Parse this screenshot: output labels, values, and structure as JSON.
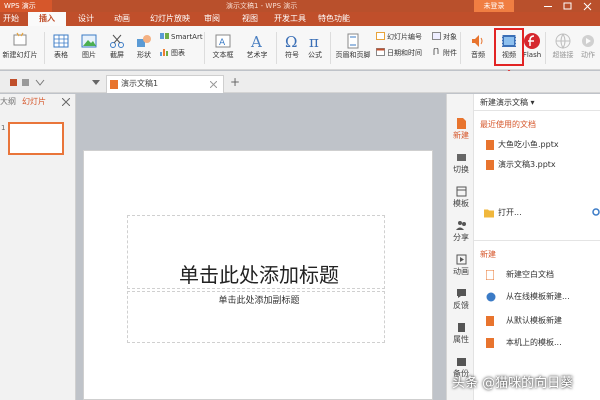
{
  "window": {
    "app_badge": "WPS 演示",
    "doc_title": "演示文稿1 - WPS 演示",
    "login_label": "未登录"
  },
  "menu": {
    "tabs": [
      {
        "label": "开始"
      },
      {
        "label": "插入",
        "active": true
      },
      {
        "label": "设计"
      },
      {
        "label": "动画"
      },
      {
        "label": "幻灯片放映"
      },
      {
        "label": "审阅"
      },
      {
        "label": "视图"
      },
      {
        "label": "开发工具"
      },
      {
        "label": "特色功能"
      }
    ]
  },
  "ribbon": {
    "new_slide": "新建幻灯片",
    "table": "表格",
    "picture": "图片",
    "screenshot": "截屏",
    "shape": "形状",
    "smartart": "SmartArt",
    "chart": "图表",
    "textbox": "文本框",
    "wordart": "艺术字",
    "symbol": "符号",
    "formula": "公式",
    "header_footer": "页眉和页脚",
    "slide_number": "幻灯片编号",
    "object": "对象",
    "date_time": "日期和时间",
    "attachment": "附件",
    "audio": "音频",
    "video": "视频",
    "flash": "Flash",
    "hyperlink": "超链接",
    "action": "动作",
    "colors": {
      "accent": "#c04f2b",
      "highlight": "#e22424"
    }
  },
  "tabs": {
    "doc_tab": "演示文稿1",
    "add": "+"
  },
  "left_panel": {
    "outline_tab": "大纲",
    "slides_tab": "幻灯片",
    "slide_number": "1"
  },
  "slide": {
    "title": "单击此处添加标题",
    "subtitle": "单击此处添加副标题"
  },
  "side_strip": [
    {
      "label": "新建"
    },
    {
      "label": "切换"
    },
    {
      "label": "模板"
    },
    {
      "label": "分享"
    },
    {
      "label": "动画"
    },
    {
      "label": "反馈"
    },
    {
      "label": "属性"
    },
    {
      "label": "备份"
    }
  ],
  "right_panel": {
    "header": "新建演示文稿",
    "recent_title": "最近使用的文档",
    "recent_files": [
      "大鱼吃小鱼.pptx",
      "演示文稿3.pptx"
    ],
    "open": "打开...",
    "new_title": "新建",
    "new_items": [
      "新建空白文档",
      "从在线模板新建...",
      "从默认模板新建",
      "本机上的模板..."
    ]
  },
  "watermark": "头条 @猫咪的向日葵"
}
